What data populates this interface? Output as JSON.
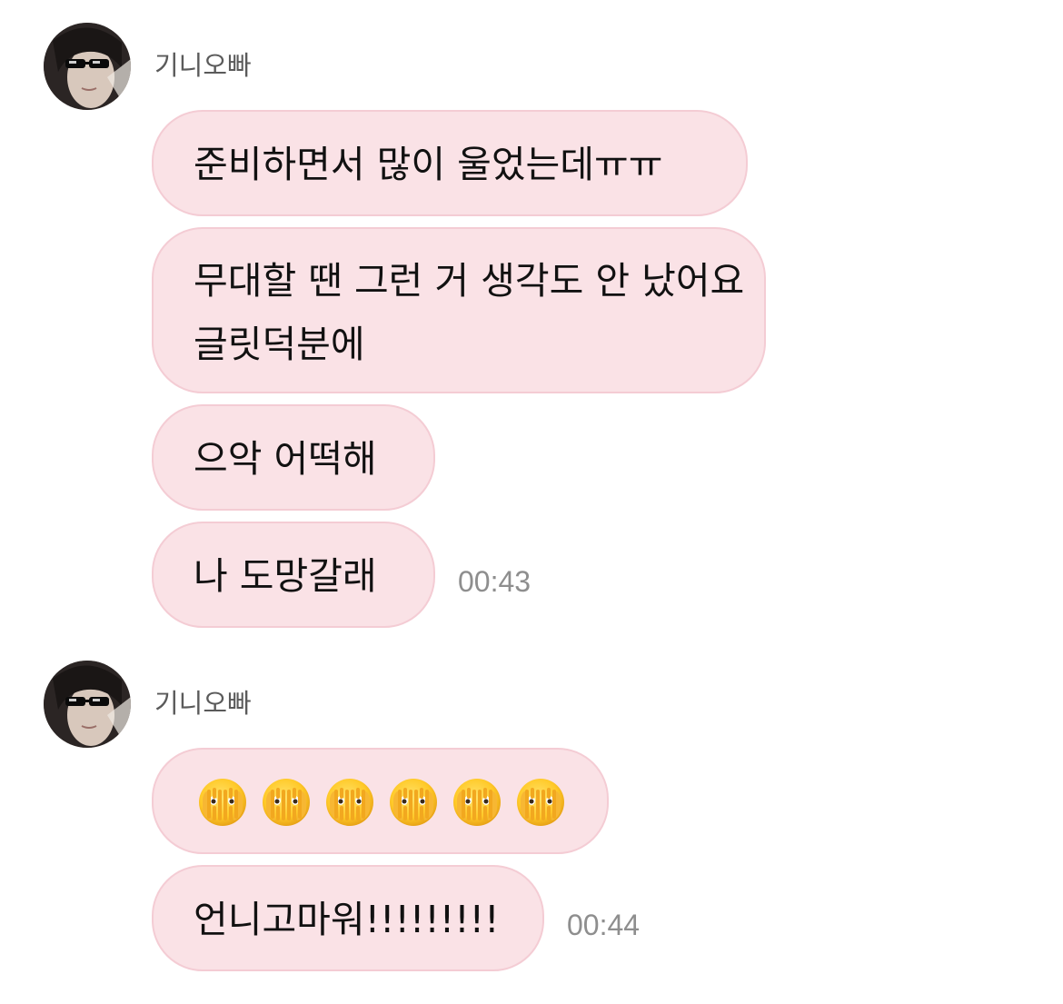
{
  "messages_group_1": {
    "sender": "기니오빠",
    "bubbles": [
      "준비하면서 많이 울었는데ㅠㅠ",
      "무대할 땐 그런 거 생각도 안 났어요",
      "글릿덕분에",
      "으악 어떡해",
      "나 도망갈래"
    ],
    "timestamp": "00:43"
  },
  "messages_group_2": {
    "sender": "기니오빠",
    "emoji_icons": [
      "face-with-peeking-eye",
      "face-with-peeking-eye",
      "face-with-peeking-eye",
      "face-with-peeking-eye",
      "face-with-peeking-eye",
      "face-with-peeking-eye"
    ],
    "bubbles": [
      "언니고마워!!!!!!!!!"
    ],
    "timestamp": "00:44"
  },
  "colors": {
    "bubble_bg": "#fae2e6",
    "bubble_border": "#f4ccd4",
    "timestamp": "#8e8e8e",
    "sender_name": "#5a5a5a"
  }
}
